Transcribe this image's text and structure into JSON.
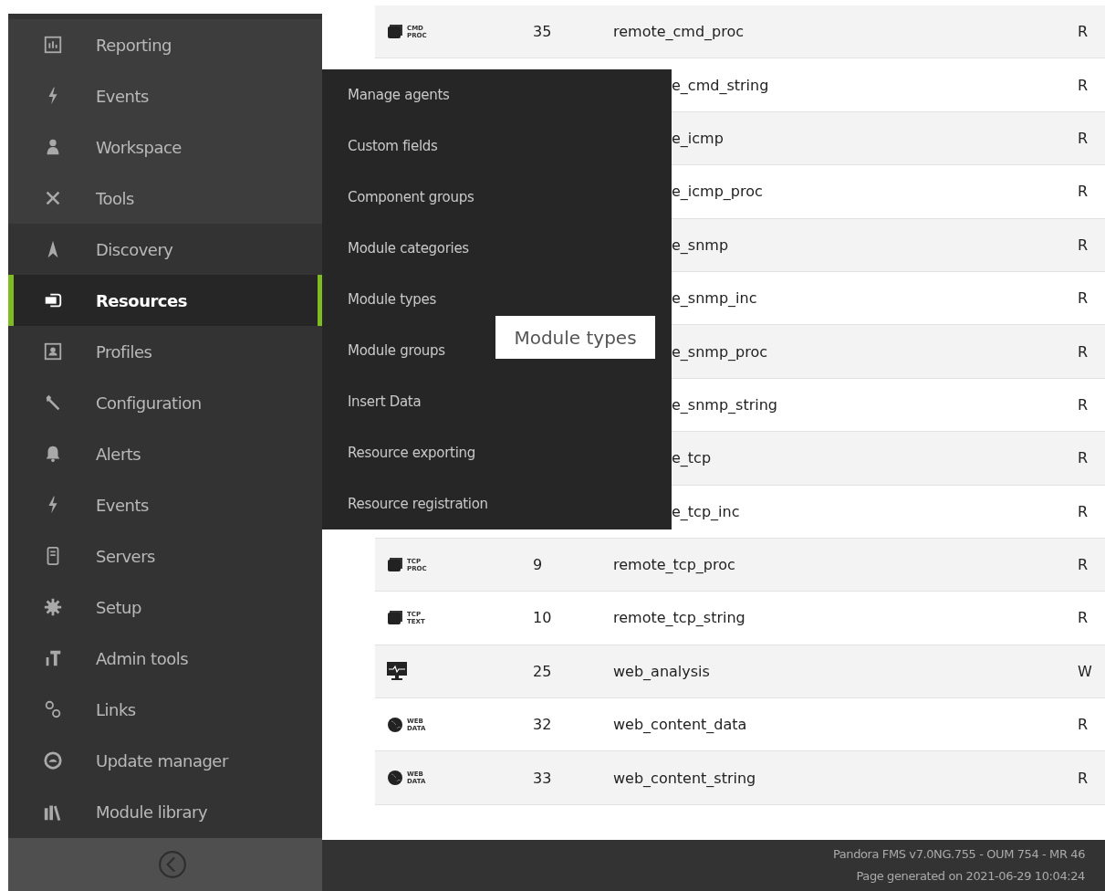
{
  "sidebar": {
    "items": [
      {
        "label": "Reporting",
        "selected": false
      },
      {
        "label": "Events",
        "selected": false
      },
      {
        "label": "Workspace",
        "selected": false
      },
      {
        "label": "Tools",
        "selected": false
      },
      {
        "label": "Discovery",
        "selected": false
      },
      {
        "label": "Resources",
        "selected": true
      },
      {
        "label": "Profiles",
        "selected": false
      },
      {
        "label": "Configuration",
        "selected": false
      },
      {
        "label": "Alerts",
        "selected": false
      },
      {
        "label": "Events",
        "selected": false
      },
      {
        "label": "Servers",
        "selected": false
      },
      {
        "label": "Setup",
        "selected": false
      },
      {
        "label": "Admin tools",
        "selected": false
      },
      {
        "label": "Links",
        "selected": false
      },
      {
        "label": "Update manager",
        "selected": false
      },
      {
        "label": "Module library",
        "selected": false
      }
    ]
  },
  "submenu": {
    "items": [
      "Manage agents",
      "Custom fields",
      "Component groups",
      "Module categories",
      "Module types",
      "Module groups",
      "Insert Data",
      "Resource exporting",
      "Resource registration"
    ]
  },
  "tooltip": "Module types",
  "table": {
    "rows": [
      {
        "kind": "terminal",
        "icon_text": [
          "CMD",
          "PROC"
        ],
        "id": "35",
        "name": "remote_cmd_proc",
        "column_4": "R"
      },
      {
        "kind": "covered",
        "name": "e_cmd_string",
        "column_4": "R"
      },
      {
        "kind": "covered",
        "name": "e_icmp",
        "column_4": "R"
      },
      {
        "kind": "covered",
        "name": "e_icmp_proc",
        "column_4": "R"
      },
      {
        "kind": "covered",
        "name": "e_snmp",
        "column_4": "R"
      },
      {
        "kind": "covered",
        "name": "e_snmp_inc",
        "column_4": "R"
      },
      {
        "kind": "covered",
        "name": "e_snmp_proc",
        "column_4": "R"
      },
      {
        "kind": "covered",
        "name": "e_snmp_string",
        "column_4": "R"
      },
      {
        "kind": "covered",
        "name": "e_tcp",
        "column_4": "R"
      },
      {
        "kind": "covered",
        "name": "e_tcp_inc",
        "column_4": "R"
      },
      {
        "kind": "terminal",
        "icon_text": [
          "TCP",
          "PROC"
        ],
        "id": "9",
        "name": "remote_tcp_proc",
        "column_4": "R"
      },
      {
        "kind": "terminal",
        "icon_text": [
          "TCP",
          "TEXT"
        ],
        "id": "10",
        "name": "remote_tcp_string",
        "column_4": "R"
      },
      {
        "kind": "monitor",
        "id": "25",
        "name": "web_analysis",
        "column_4": "W"
      },
      {
        "kind": "globe",
        "icon_text": [
          "WEB",
          "DATA"
        ],
        "id": "32",
        "name": "web_content_data",
        "column_4": "R"
      },
      {
        "kind": "globe",
        "icon_text": [
          "WEB",
          "DATA"
        ],
        "id": "33",
        "name": "web_content_string",
        "column_4": "R"
      }
    ]
  },
  "footer": [
    "Pandora FMS v7.0NG.755 - OUM 754 - MR 46",
    "Page generated on 2021-06-29 10:04:24"
  ]
}
